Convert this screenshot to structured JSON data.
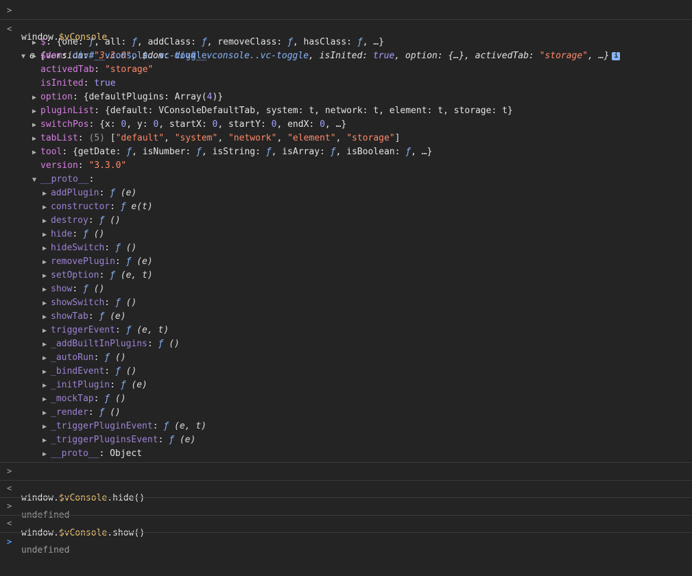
{
  "entries": [
    {
      "type": "input",
      "code": "window.$vConsole"
    },
    {
      "type": "output-object",
      "summary": {
        "name": "e",
        "prefix": "{version: ",
        "version": "\"3.3.0\"",
        "dom_label": ", $dom: ",
        "dom_value": "div#__vconsole..vc-toggle",
        "inited_label": ", isInited: ",
        "inited_value": "true",
        "option_label": ", option: {…}, activedTab: ",
        "actived_value": "\"storage\"",
        "tail": ", …}"
      },
      "props": [
        {
          "key": "$",
          "expandable": true,
          "value": "{one: ƒ, all: ƒ, addClass: ƒ, removeClass: ƒ, hasClass: ƒ, …}"
        },
        {
          "key": "$dom",
          "expandable": true,
          "value": "div#__vconsole..vc-toggle"
        },
        {
          "key": "activedTab",
          "expandable": false,
          "value": "\"storage\""
        },
        {
          "key": "isInited",
          "expandable": false,
          "value": "true"
        },
        {
          "key": "option",
          "expandable": true,
          "value": "{defaultPlugins: Array(4)}"
        },
        {
          "key": "pluginList",
          "expandable": true,
          "value": "{default: VConsoleDefaultTab, system: t, network: t, element: t, storage: t}"
        },
        {
          "key": "switchPos",
          "expandable": true,
          "value": "{x: 0, y: 0, startX: 0, startY: 0, endX: 0, …}"
        },
        {
          "key": "tabList",
          "expandable": true,
          "count": "(5)",
          "value": "[\"default\", \"system\", \"network\", \"element\", \"storage\"]"
        },
        {
          "key": "tool",
          "expandable": true,
          "value": "{getDate: ƒ, isNumber: ƒ, isString: ƒ, isArray: ƒ, isBoolean: ƒ, …}"
        },
        {
          "key": "version",
          "expandable": false,
          "value": "\"3.3.0\""
        }
      ],
      "proto_label": "__proto__",
      "proto_methods": [
        {
          "key": "addPlugin",
          "args": "(e)"
        },
        {
          "key": "constructor",
          "args": "e(t)"
        },
        {
          "key": "destroy",
          "args": "()"
        },
        {
          "key": "hide",
          "args": "()"
        },
        {
          "key": "hideSwitch",
          "args": "()"
        },
        {
          "key": "removePlugin",
          "args": "(e)"
        },
        {
          "key": "setOption",
          "args": "(e, t)"
        },
        {
          "key": "show",
          "args": "()"
        },
        {
          "key": "showSwitch",
          "args": "()"
        },
        {
          "key": "showTab",
          "args": "(e)"
        },
        {
          "key": "triggerEvent",
          "args": "(e, t)"
        },
        {
          "key": "_addBuiltInPlugins",
          "args": "()"
        },
        {
          "key": "_autoRun",
          "args": "()"
        },
        {
          "key": "_bindEvent",
          "args": "()"
        },
        {
          "key": "_initPlugin",
          "args": "(e)"
        },
        {
          "key": "_mockTap",
          "args": "()"
        },
        {
          "key": "_render",
          "args": "()"
        },
        {
          "key": "_triggerPluginEvent",
          "args": "(e, t)"
        },
        {
          "key": "_triggerPluginsEvent",
          "args": "(e)"
        }
      ],
      "proto_last": {
        "key": "__proto__",
        "value": "Object"
      }
    },
    {
      "type": "input",
      "code_prefix": "window.",
      "code_var": "$vConsole",
      "code_suffix": ".hide()"
    },
    {
      "type": "output",
      "value": "undefined"
    },
    {
      "type": "input",
      "code_prefix": "window.",
      "code_var": "$vConsole",
      "code_suffix": ".show()"
    },
    {
      "type": "output",
      "value": "undefined"
    }
  ],
  "first_input": {
    "prefix": "window.",
    "var": "$vConsole"
  },
  "fn_symbol": "ƒ",
  "colon": ": ",
  "info_badge": "i",
  "prompt_in": ">",
  "prompt_out": "<",
  "expand_open": "▼",
  "expand_closed": "▶"
}
